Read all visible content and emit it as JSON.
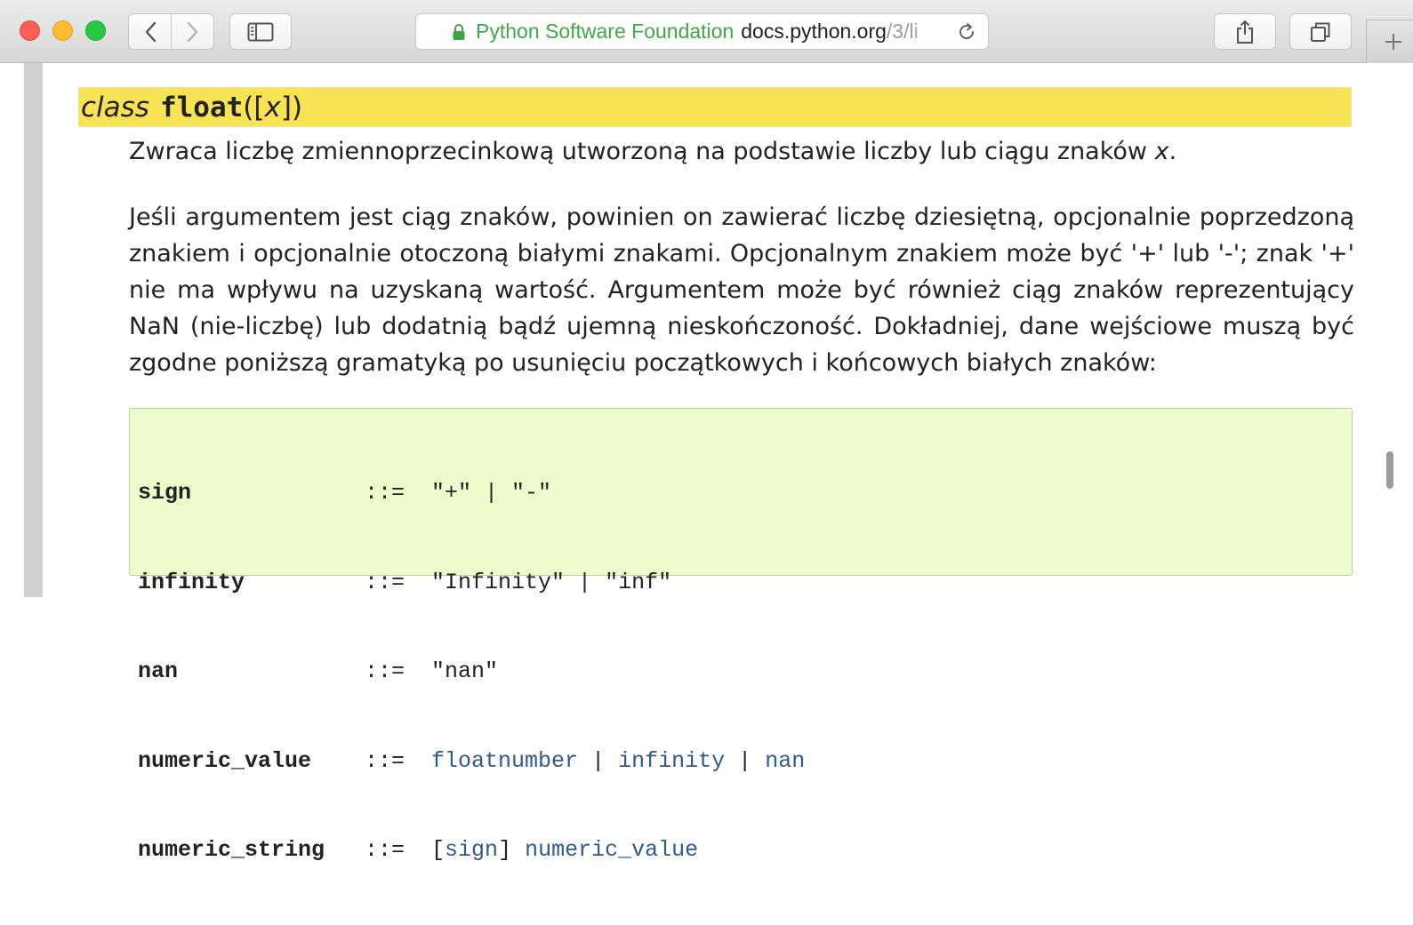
{
  "browser": {
    "address": {
      "site_owner": "Python Software Foundation",
      "host": "docs.python.org",
      "path": "/3/li"
    },
    "icons": [
      "back-icon",
      "forward-icon",
      "sidebar-icon",
      "lock-icon",
      "reload-icon",
      "share-icon",
      "tabs-icon",
      "plus-icon"
    ]
  },
  "doc": {
    "signature": {
      "keyword": "class",
      "name": "float",
      "open": "([",
      "param": "x",
      "close": "])"
    },
    "para1": {
      "text": "Zwraca liczbę zmiennoprzecinkową utworzoną na podstawie liczby lub ciągu znaków ",
      "var": "x",
      "end": "."
    },
    "para2": "Jeśli argumentem jest ciąg znaków, powinien on zawierać liczbę dziesiętną, opcjonalnie poprzedzoną znakiem i opcjonalnie otoczoną białymi znakami. Opcjonalnym znakiem może być '+' lub '-'; znak '+' nie ma wpływu na uzyskaną wartość. Argumentem może być również ciąg znaków reprezentujący NaN (nie-liczbę) lub dodatnią bądź ujemną nieskończoność. Dokładniej, dane wejściowe muszą być zgodne poniższą gramatyką po usunięciu początkowych i końcowych białych znaków:",
    "grammar": {
      "op": "::=",
      "sep": "|",
      "rules": [
        {
          "lhs": "sign",
          "rhs": "\"+\" | \"-\""
        },
        {
          "lhs": "infinity",
          "rhs": "\"Infinity\" | \"inf\""
        },
        {
          "lhs": "nan",
          "rhs": "\"nan\""
        }
      ],
      "numeric_value": {
        "lhs": "numeric_value",
        "a": "floatnumber",
        "b": "infinity",
        "c": "nan"
      },
      "numeric_string": {
        "lhs": "numeric_string",
        "open": "[",
        "ref1": "sign",
        "close": "]",
        "ref2": "numeric_value"
      }
    }
  },
  "colors": {
    "signature_bg": "#f8e355",
    "code_bg": "#eefbcd",
    "code_border": "#b7d591",
    "link": "#2f5a8a",
    "secure_green": "#3fa845"
  }
}
